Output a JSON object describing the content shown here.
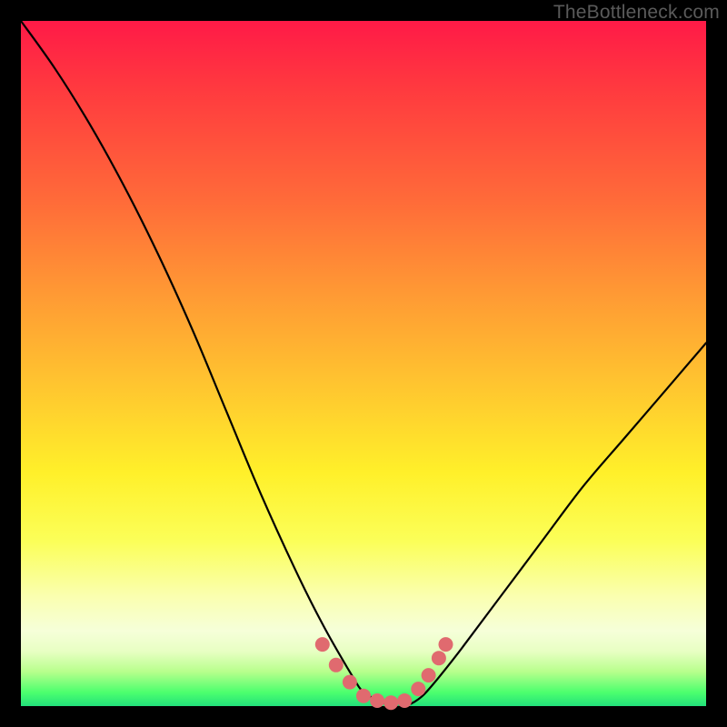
{
  "watermark": "TheBottleneck.com",
  "colors": {
    "frame": "#000000",
    "curve": "#000000",
    "marker_fill": "#e06a6f",
    "marker_stroke": "#d85a60"
  },
  "chart_data": {
    "type": "line",
    "title": "",
    "xlabel": "",
    "ylabel": "",
    "xlim": [
      0,
      100
    ],
    "ylim": [
      0,
      100
    ],
    "grid": false,
    "series": [
      {
        "name": "bottleneck-curve",
        "note": "V-shaped curve; y ≈ 100 at x=0, drops to ~0 around x≈50–58, rises to ~53 at x=100. Values estimated from pixel positions (no axis ticks visible).",
        "x": [
          0,
          5,
          10,
          15,
          20,
          25,
          30,
          35,
          40,
          44,
          48,
          50,
          52,
          54,
          56,
          58,
          60,
          64,
          70,
          76,
          82,
          88,
          94,
          100
        ],
        "values": [
          100,
          93,
          85,
          76,
          66,
          55,
          43,
          31,
          20,
          12,
          5,
          2,
          1,
          0,
          0,
          1,
          3,
          8,
          16,
          24,
          32,
          39,
          46,
          53
        ]
      }
    ],
    "markers": {
      "name": "highlight-dots",
      "note": "Salmon dots clustered around the valley floor, estimated.",
      "points": [
        {
          "x": 44.0,
          "y": 9.0
        },
        {
          "x": 46.0,
          "y": 6.0
        },
        {
          "x": 48.0,
          "y": 3.5
        },
        {
          "x": 50.0,
          "y": 1.5
        },
        {
          "x": 52.0,
          "y": 0.8
        },
        {
          "x": 54.0,
          "y": 0.5
        },
        {
          "x": 56.0,
          "y": 0.8
        },
        {
          "x": 58.0,
          "y": 2.5
        },
        {
          "x": 59.5,
          "y": 4.5
        },
        {
          "x": 61.0,
          "y": 7.0
        },
        {
          "x": 62.0,
          "y": 9.0
        }
      ]
    }
  }
}
